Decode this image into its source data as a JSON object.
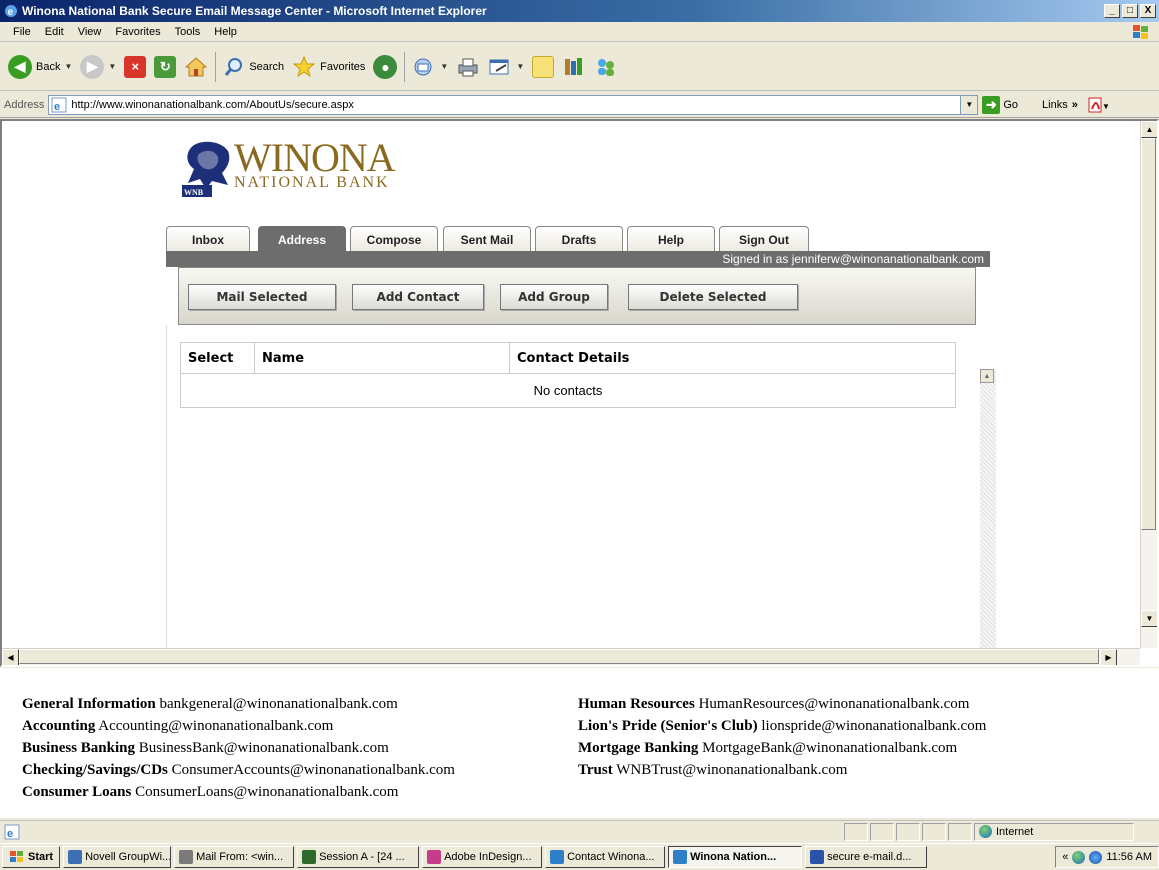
{
  "window": {
    "title": "Winona National Bank Secure Email Message Center - Microsoft Internet Explorer",
    "min": "_",
    "max": "□",
    "close": "X"
  },
  "menu": [
    "File",
    "Edit",
    "View",
    "Favorites",
    "Tools",
    "Help"
  ],
  "toolbar": {
    "back": "Back",
    "search": "Search",
    "favorites": "Favorites"
  },
  "address": {
    "label": "Address",
    "url": "http://www.winonanationalbank.com/AboutUs/secure.aspx",
    "go": "Go",
    "links": "Links"
  },
  "logo": {
    "main": "WINONA",
    "sub": "NATIONAL BANK",
    "mark_text": "WNB"
  },
  "tabs": [
    "Inbox",
    "Address",
    "Compose",
    "Sent Mail",
    "Drafts",
    "Help",
    "Sign Out"
  ],
  "active_tab": "Address",
  "signed_in": "Signed in as jenniferw@winonanationalbank.com",
  "actions": [
    "Mail Selected",
    "Add Contact",
    "Add Group",
    "Delete Selected"
  ],
  "table": {
    "headers": [
      "Select",
      "Name",
      "Contact Details"
    ],
    "empty": "No contacts"
  },
  "footer": {
    "left": [
      {
        "label": "General Information",
        "email": "bankgeneral@winonanationalbank.com"
      },
      {
        "label": "Accounting",
        "email": "Accounting@winonanationalbank.com"
      },
      {
        "label": "Business Banking",
        "email": "BusinessBank@winonanationalbank.com"
      },
      {
        "label": "Checking/Savings/CDs",
        "email": "ConsumerAccounts@winonanationalbank.com"
      },
      {
        "label": "Consumer Loans",
        "email": "ConsumerLoans@winonanationalbank.com"
      }
    ],
    "right": [
      {
        "label": "Human Resources",
        "email": "HumanResources@winonanationalbank.com"
      },
      {
        "label": "Lion's Pride (Senior's Club)",
        "email": "lionspride@winonanationalbank.com"
      },
      {
        "label": "Mortgage Banking",
        "email": "MortgageBank@winonanationalbank.com"
      },
      {
        "label": "Trust",
        "email": "WNBTrust@winonanationalbank.com"
      }
    ]
  },
  "status": {
    "zone": "Internet"
  },
  "taskbar": {
    "start": "Start",
    "tasks": [
      {
        "label": "Novell GroupWi...",
        "color": "#3b6fb6"
      },
      {
        "label": "Mail From: <win...",
        "color": "#7a7a7a"
      },
      {
        "label": "Session A - [24 ...",
        "color": "#2c6b2c"
      },
      {
        "label": "Adobe InDesign...",
        "color": "#c43c8a"
      },
      {
        "label": "Contact Winona...",
        "color": "#2f7ec8"
      },
      {
        "label": "Winona Nation...",
        "color": "#2f7ec8"
      },
      {
        "label": "secure e-mail.d...",
        "color": "#2a52a8"
      }
    ],
    "active_task": "Winona Nation...",
    "tray_chevron": "«",
    "clock": "11:56 AM"
  },
  "colors": {
    "brand_gold": "#8a6a1f",
    "tab_active": "#6d6d6d"
  }
}
